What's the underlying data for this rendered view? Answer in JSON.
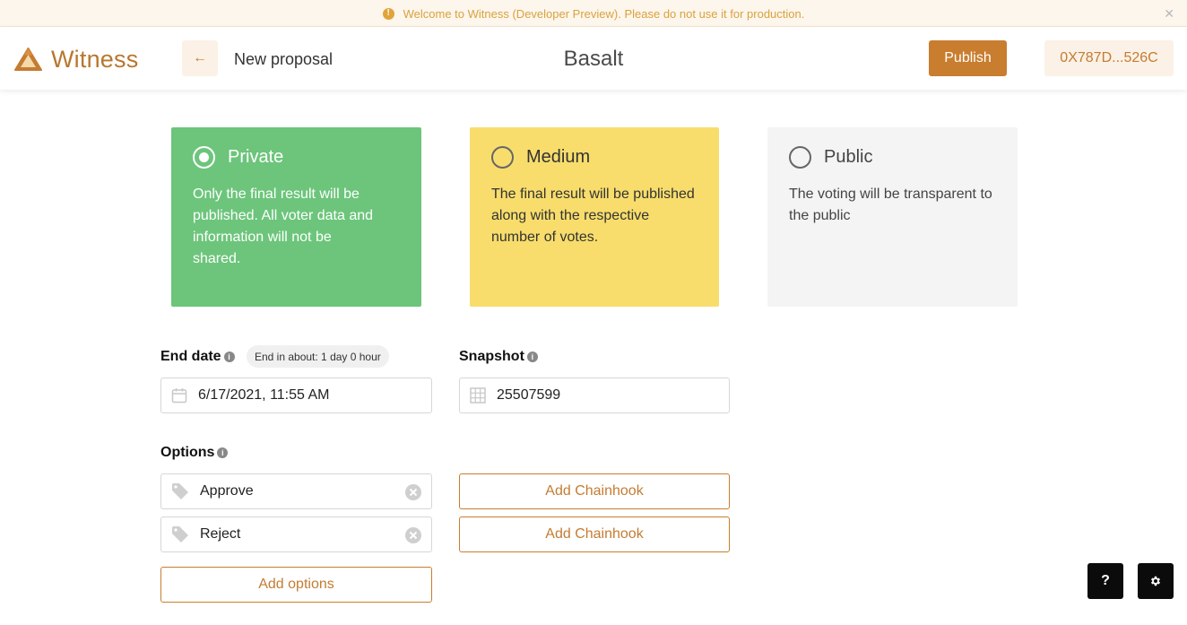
{
  "banner": {
    "message": "Welcome to Witness (Developer Preview). Please do not use it for production.",
    "icon": "warning-icon",
    "close_icon": "close-icon"
  },
  "header": {
    "app_name": "Witness",
    "back_icon": "arrow-left-icon",
    "back_glyph": "←",
    "page_title": "New proposal",
    "space_name": "Basalt",
    "publish_label": "Publish",
    "wallet_address": "0X787D...526C"
  },
  "privacy": {
    "selected": "private",
    "options": [
      {
        "id": "private",
        "title": "Private",
        "description": "Only the final result will be published. All voter data and information will not be shared.",
        "color": "#6cc57b"
      },
      {
        "id": "medium",
        "title": "Medium",
        "description": "The final result will be published along with the respective number of votes.",
        "color": "#f8dd6c"
      },
      {
        "id": "public",
        "title": "Public",
        "description": "The voting will be transparent to the public",
        "color": "#f4f4f4"
      }
    ]
  },
  "end_date": {
    "label": "End date",
    "hint": "End in about: 1 day 0 hour",
    "value": "6/17/2021, 11:55 AM",
    "icon": "calendar-icon"
  },
  "snapshot": {
    "label": "Snapshot",
    "value": "25507599",
    "icon": "grid-icon"
  },
  "options": {
    "label": "Options",
    "items": [
      {
        "value": "Approve",
        "chainhook_label": "Add Chainhook"
      },
      {
        "value": "Reject",
        "chainhook_label": "Add Chainhook"
      }
    ],
    "add_label": "Add options"
  },
  "corner": {
    "help_label": "?",
    "settings_icon": "gear-icon"
  },
  "colors": {
    "accent": "#c97d2e",
    "accent_light": "#fbf1e6",
    "banner_bg": "#fdf6ec"
  }
}
